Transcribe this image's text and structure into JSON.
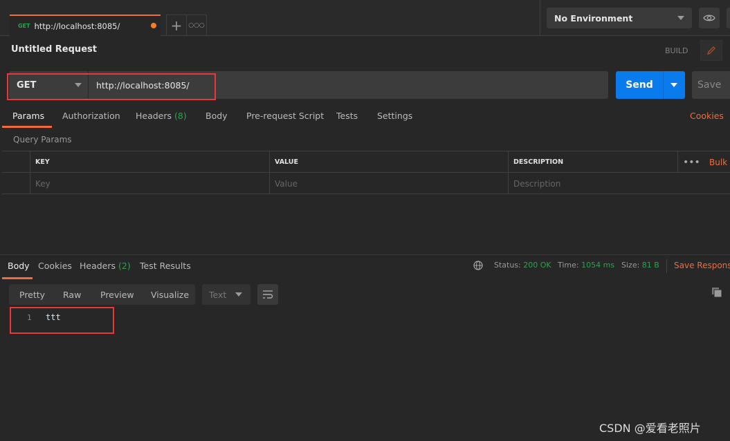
{
  "tab": {
    "method": "GET",
    "url": "http://localhost:8085/",
    "unsaved": true
  },
  "tab_actions": {
    "new_icon": "plus-icon",
    "more_icon": "ellipsis-icon"
  },
  "environment": {
    "selected": "No Environment"
  },
  "request": {
    "title": "Untitled Request",
    "mode": "BUILD",
    "method": "GET",
    "url": "http://localhost:8085/",
    "send_label": "Send",
    "save_label": "Save"
  },
  "request_tabs": [
    {
      "label": "Params",
      "active": true
    },
    {
      "label": "Authorization"
    },
    {
      "label": "Headers",
      "count": "(8)"
    },
    {
      "label": "Body"
    },
    {
      "label": "Pre-request Script"
    },
    {
      "label": "Tests"
    },
    {
      "label": "Settings"
    }
  ],
  "cookies_link": "Cookies",
  "query_params": {
    "title": "Query Params",
    "columns": [
      "KEY",
      "VALUE",
      "DESCRIPTION"
    ],
    "bulk_edit": "Bulk",
    "placeholders": [
      "Key",
      "Value",
      "Description"
    ]
  },
  "response_tabs": [
    {
      "label": "Body",
      "active": true
    },
    {
      "label": "Cookies"
    },
    {
      "label": "Headers",
      "count": "(2)"
    },
    {
      "label": "Test Results"
    }
  ],
  "response_status": {
    "status_label": "Status:",
    "status": "200 OK",
    "time_label": "Time:",
    "time": "1054 ms",
    "size_label": "Size:",
    "size": "81 B",
    "save_response": "Save Response"
  },
  "view_modes": [
    "Pretty",
    "Raw",
    "Preview",
    "Visualize"
  ],
  "format": "Text",
  "response_body": {
    "line": "1",
    "content": "ttt"
  },
  "colors": {
    "accent": "#f26b3a",
    "send": "#097bed",
    "success": "#2ea24d",
    "highlight_box": "#e8383b"
  },
  "watermark": "CSDN @爱看老照片"
}
